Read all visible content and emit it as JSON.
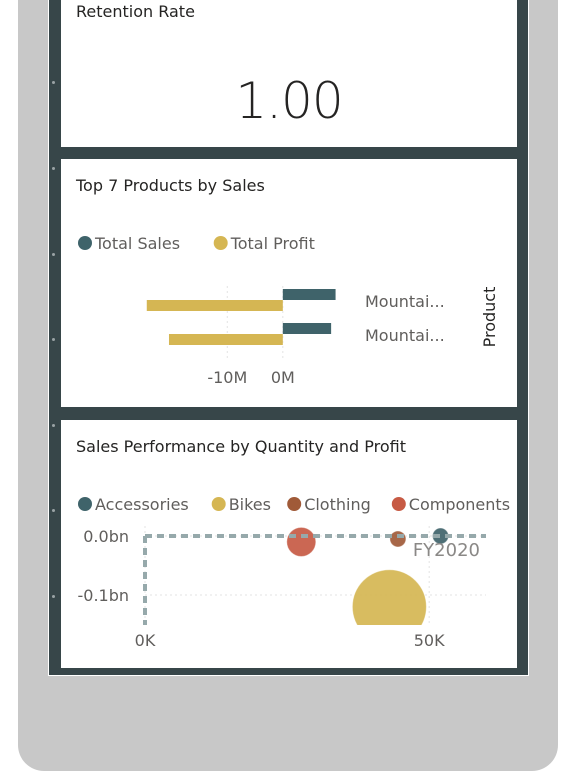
{
  "kpi_card": {
    "title": "Retention Rate",
    "value": "1.00"
  },
  "products_card": {
    "title": "Top 7 Products by Sales"
  },
  "performance_card": {
    "title": "Sales Performance by Quantity and Profit"
  },
  "colors": {
    "total_sales": "#3f636a",
    "total_profit": "#d5b653",
    "accessories": "#3f636a",
    "bikes": "#d5b653",
    "clothing": "#a05a38",
    "components": "#c75a44",
    "canvas": "#374649"
  },
  "chart_data": [
    {
      "type": "bar",
      "orientation": "horizontal",
      "legend_position": "top-left",
      "categories": [
        "Mountai...",
        "Mountai..."
      ],
      "series": [
        {
          "name": "Total Sales",
          "values": [
            9500000,
            8700000
          ]
        },
        {
          "name": "Total Profit",
          "values": [
            -24500000,
            -20500000
          ]
        }
      ],
      "xlabel": "",
      "ylabel": "Product",
      "xlim": [
        -25000000,
        13000000
      ],
      "xticks": [
        {
          "value": -10000000,
          "label": "-10M"
        },
        {
          "value": 0,
          "label": "0M"
        }
      ],
      "grid": true
    },
    {
      "type": "scatter",
      "legend_position": "top-left",
      "series": [
        {
          "name": "Accessories",
          "points": [
            {
              "x": 52000,
              "y": 0.0,
              "size": 55000000
            }
          ]
        },
        {
          "name": "Bikes",
          "points": [
            {
              "x": 43000,
              "y": -0.12,
              "size": 6800000000
            }
          ]
        },
        {
          "name": "Clothing",
          "points": [
            {
              "x": 44500,
              "y": -0.005,
              "size": 250000000
            }
          ]
        },
        {
          "name": "Components",
          "points": [
            {
              "x": 27500,
              "y": -0.01,
              "size": 1050000000
            }
          ]
        }
      ],
      "xlim": [
        0,
        60000
      ],
      "ylim": [
        -0.15,
        0.02
      ],
      "xticks": [
        {
          "value": 0,
          "label": "0K"
        },
        {
          "value": 50000,
          "label": "50K"
        }
      ],
      "yticks": [
        {
          "value": 0,
          "label": "0.0bn"
        },
        {
          "value": -0.1,
          "label": "-0.1bn"
        }
      ],
      "annotations": [
        {
          "text": "FY2020",
          "x": 57000,
          "y": -0.01
        }
      ],
      "grid": true,
      "reference_lines": [
        "dashed play axis at x=0 and y=0"
      ]
    }
  ]
}
